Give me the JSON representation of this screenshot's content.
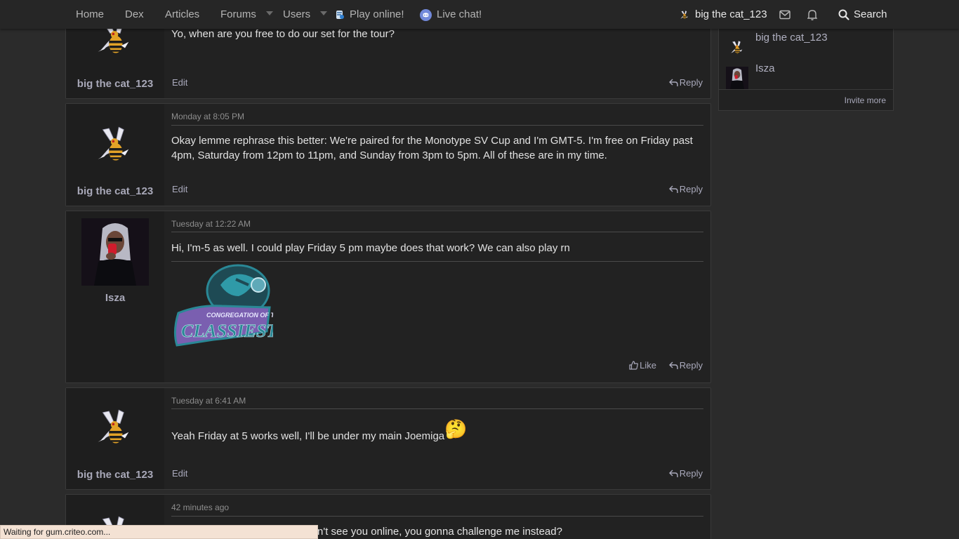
{
  "nav": {
    "home": "Home",
    "dex": "Dex",
    "articles": "Articles",
    "forums": "Forums",
    "users": "Users",
    "play_online": "Play online!",
    "live_chat": "Live chat!",
    "account_name": "big the cat_123",
    "search": "Search"
  },
  "posts": [
    {
      "author": "big the cat_123",
      "timestamp": "",
      "body": "Yo, when are you free to do our set for the tour?",
      "edit": "Edit",
      "reply": "Reply"
    },
    {
      "author": "big the cat_123",
      "timestamp": "Monday at 8:05 PM",
      "body": "Okay lemme rephrase this better: We're paired for the Monotype SV Cup and I'm GMT-5. I'm free on Friday past 4pm, Saturday from 12pm to 11pm, and Sunday from 3pm to 5pm. All of these are in my time.",
      "edit": "Edit",
      "reply": "Reply"
    },
    {
      "author": "Isza",
      "timestamp": "Tuesday at 12:22 AM",
      "body": "Hi, I'm-5 as well. I could play Friday 5 pm maybe does that work? We can also play rn",
      "image_text_top": "CONGREGATION OF THE",
      "image_text_main": "CLASSIEST",
      "like": "Like",
      "reply": "Reply"
    },
    {
      "author": "big the cat_123",
      "timestamp": "Tuesday at 6:41 AM",
      "body": "Yeah Friday at 5 works well, I'll be under my main Joemiga",
      "emoji": "🤔",
      "edit": "Edit",
      "reply": "Reply"
    },
    {
      "author": "",
      "timestamp": "42 minutes ago",
      "body": "n't see you online, you gonna challenge me instead?"
    }
  ],
  "sidebar": {
    "members": [
      "big the cat_123",
      "Isza"
    ],
    "invite": "Invite more"
  },
  "status_bar": "Waiting for gum.criteo.com...",
  "colors": {
    "page_bg": "#2b2b2b",
    "nav_bg": "#262626",
    "post_bg": "#222222",
    "link": "#a9a9bb",
    "discord": "#7289da"
  }
}
